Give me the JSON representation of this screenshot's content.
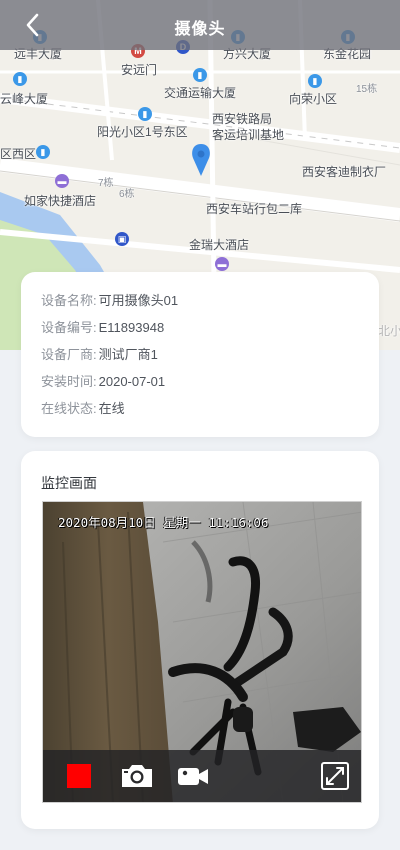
{
  "header": {
    "title": "摄像头"
  },
  "map": {
    "labels": [
      "远丰大厦",
      "安远门",
      "方兴大厦",
      "东金花园",
      "云峰大厦",
      "交通运输大厦",
      "向荣小区",
      "15栋",
      "阳光小区1号东区",
      "西安铁路局",
      "客运培训基地",
      "区西区",
      "西安客迪制衣厂",
      "7栋",
      "6栋",
      "如家快捷酒店",
      "西安车站行包二库",
      "金瑞大酒店",
      "北小"
    ]
  },
  "device_info": {
    "rows": [
      {
        "label": "设备名称:",
        "value": "可用摄像头01"
      },
      {
        "label": "设备编号:",
        "value": "E11893948"
      },
      {
        "label": "设备厂商:",
        "value": "测试厂商1"
      },
      {
        "label": "安装时间:",
        "value": "2020-07-01"
      },
      {
        "label": "在线状态:",
        "value": "在线"
      }
    ]
  },
  "monitor": {
    "title": "监控画面",
    "timestamp": "2020年08月10日  星期一  11:16:06",
    "controls": [
      "stop-icon",
      "camera-icon",
      "video-camera-icon",
      "fullscreen-icon"
    ],
    "stop_color": "#ff0000"
  }
}
